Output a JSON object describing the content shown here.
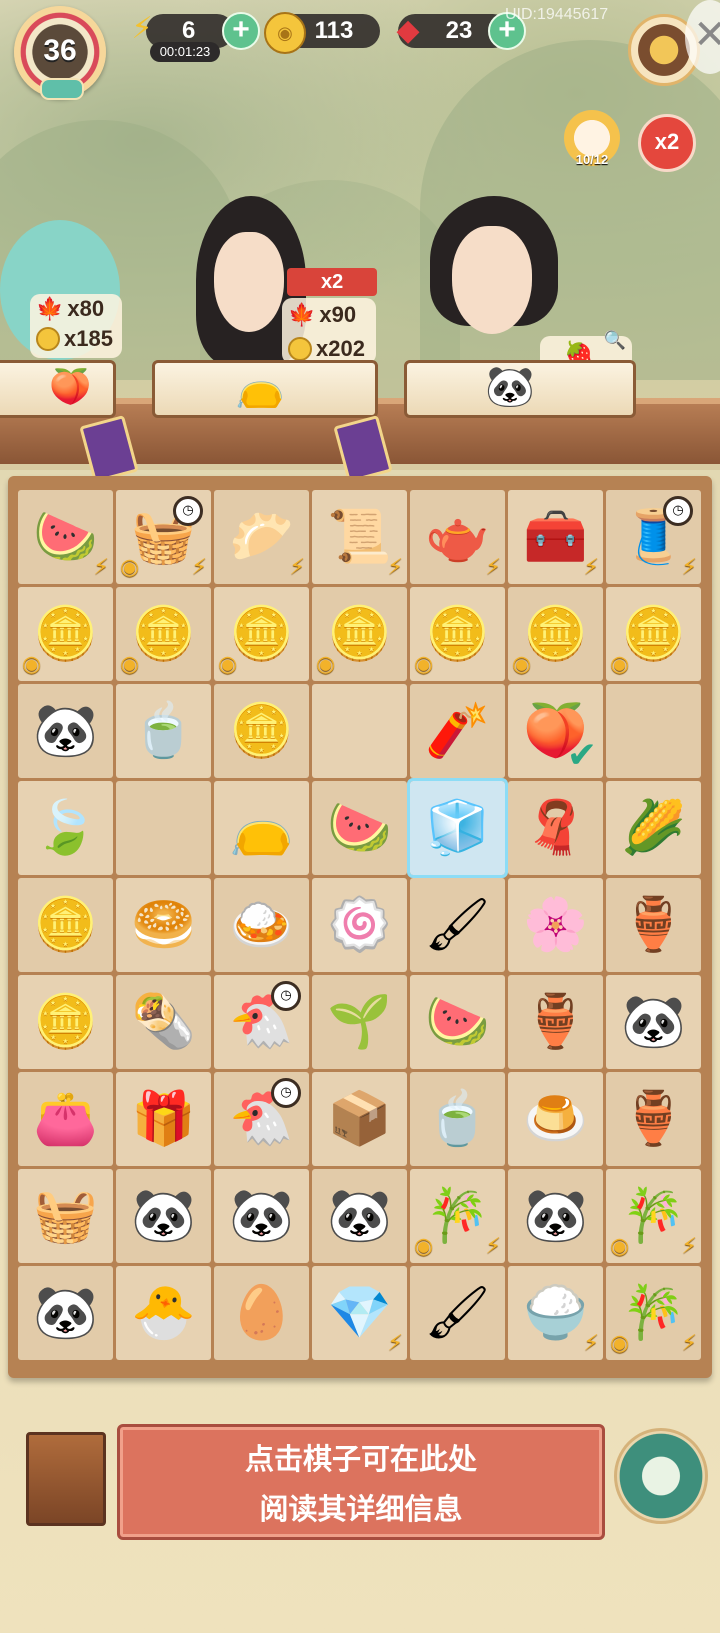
{
  "header": {
    "level": "36",
    "energy": {
      "value": "6",
      "timer": "00:01:23",
      "icon": "lightning-icon"
    },
    "coins": {
      "value": "113",
      "icon": "coin-icon"
    },
    "gems": {
      "value": "23",
      "icon": "red-gem-icon"
    },
    "uid": "UID:19445617",
    "cat_collection": "10/12",
    "boost_label": "x2"
  },
  "orders": [
    {
      "leaf_reward": "x80",
      "coin_reward": "x185"
    },
    {
      "bonus": "x2",
      "leaf_reward": "x90",
      "coin_reward": "x202"
    }
  ],
  "board": {
    "rows": [
      [
        "fruit-crate",
        "bamboo-shoot-basket",
        "dim-sum-basket",
        "scroll-bundle",
        "teapot-table",
        "treasure-chest",
        "silk-loom"
      ],
      [
        "coin-pile",
        "coin-pile",
        "coin-pile",
        "coin-pile",
        "coin-pile",
        "coin-pile",
        "coin-pile"
      ],
      [
        "panda-sleeping",
        "tea-bowl",
        "copper-coin",
        "empty",
        "firecrackers",
        "lotus-bun",
        "empty"
      ],
      [
        "jade-leaf",
        "empty",
        "embroidered-pouch",
        "watermelon-platter",
        "frozen-pouch",
        "folded-cloth",
        "bamboo-shoot"
      ],
      [
        "coin-stack",
        "steamed-bun",
        "fried-rice-plate",
        "pig-cake",
        "brush-ruler",
        "flower-cake",
        "green-gourd"
      ],
      [
        "two-coins",
        "spring-rolls",
        "hen-on-nest",
        "bamboo-sprouts",
        "watermelon-slice",
        "purple-gourd",
        "panda-flower-basket"
      ],
      [
        "purple-purse",
        "gift-box",
        "hen-on-nest",
        "tea-box",
        "tea-bowl",
        "rice-pudding",
        "orange-gourd"
      ],
      [
        "ruler-basket",
        "panda-bamboo",
        "panda-eating",
        "panda-sleeping",
        "bamboo-bundle",
        "panda-cub",
        "bamboo-bundle"
      ],
      [
        "panda-flower-bed",
        "chick-nest",
        "egg-nest",
        "jewelry-box",
        "brush-set",
        "rice-basket",
        "bamboo-bundle"
      ]
    ]
  },
  "info_panel": {
    "line1": "点击棋子可在此处",
    "line2": "阅读其详细信息"
  },
  "colors": {
    "board": "#b68253",
    "cell": "#e7d2b2",
    "panel": "#dc735e",
    "accent_green": "#5ec28e"
  }
}
